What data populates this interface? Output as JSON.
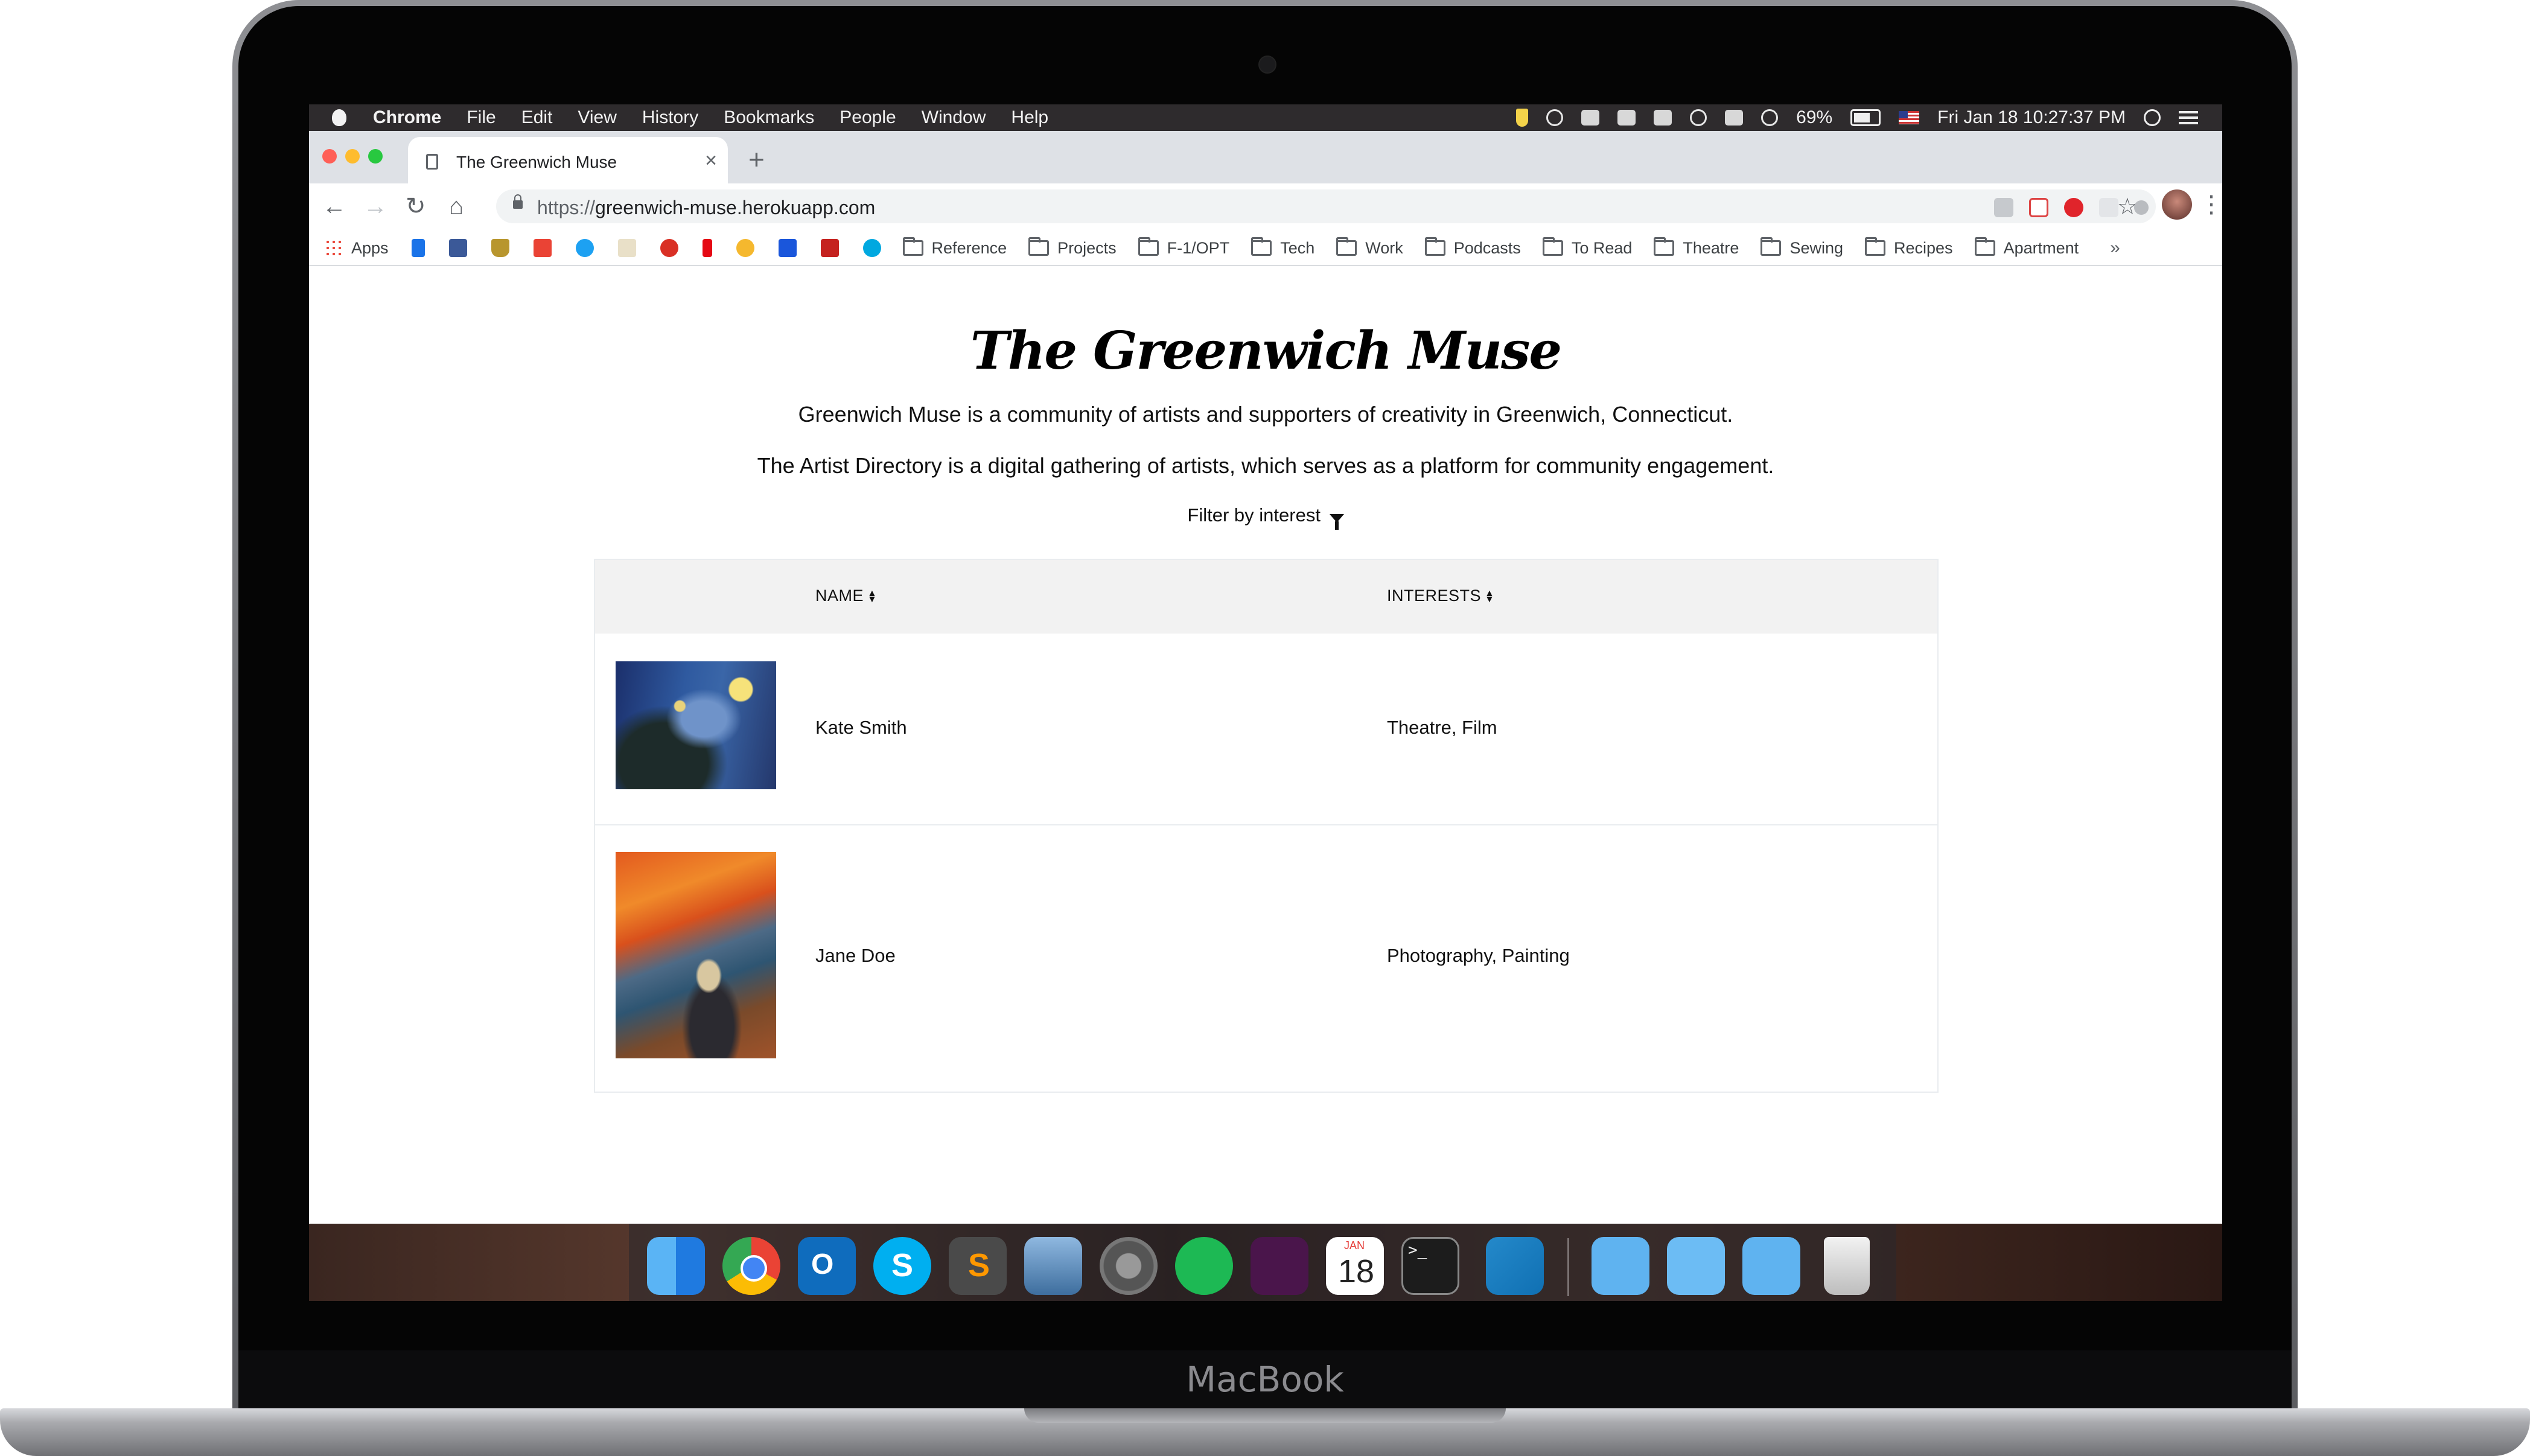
{
  "laptop": {
    "brand": "MacBook"
  },
  "menubar": {
    "app": "Chrome",
    "items": [
      "File",
      "Edit",
      "View",
      "History",
      "Bookmarks",
      "People",
      "Window",
      "Help"
    ],
    "battery": "69%",
    "clock": "Fri Jan 18  10:27:37 PM"
  },
  "browser": {
    "tab_title": "The Greenwich Muse",
    "new_tab": "+",
    "url_scheme": "https://",
    "url_host": "greenwich-muse.herokuapp.com",
    "bookmarks": {
      "apps": "Apps",
      "folders": [
        "Reference",
        "Projects",
        "F-1/OPT",
        "Tech",
        "Work",
        "Podcasts",
        "To Read",
        "Theatre",
        "Sewing",
        "Recipes",
        "Apartment"
      ],
      "overflow": "»"
    }
  },
  "page": {
    "title": "The Greenwich Muse",
    "intro1": "Greenwich Muse is a community of artists and supporters of creativity in Greenwich, Connecticut.",
    "intro2": "The Artist Directory is a digital gathering of artists, which serves as a platform for community engagement.",
    "filter_label": "Filter by interest",
    "table": {
      "headers": {
        "name": "NAME",
        "interests": "INTERESTS"
      },
      "rows": [
        {
          "name": "Kate Smith",
          "interests": "Theatre, Film",
          "thumbnail": "starry-night-painting"
        },
        {
          "name": "Jane Doe",
          "interests": "Photography, Painting",
          "thumbnail": "the-scream-painting"
        }
      ]
    }
  },
  "dock": {
    "apps": [
      "finder-icon",
      "chrome-icon",
      "outlook-icon",
      "skype-icon",
      "sublime-icon",
      "preview-icon",
      "system-preferences-icon",
      "spotify-icon",
      "slack-icon",
      "calendar-icon",
      "terminal-icon",
      "vscode-icon",
      "applications-folder-icon",
      "documents-folder-icon",
      "downloads-folder-icon",
      "trash-icon"
    ],
    "calendar_month": "JAN",
    "calendar_day": "18",
    "outlook_letter": "O",
    "skype_letter": "S",
    "sublime_letter": "S",
    "terminal_prompt": ">_"
  },
  "colors": {
    "menubar": "#2e2b2d",
    "tabstrip": "#dee1e6",
    "table_header": "#f2f2f2",
    "close_dot": "#ff5f57",
    "min_dot": "#febc2e",
    "max_dot": "#28c840"
  }
}
